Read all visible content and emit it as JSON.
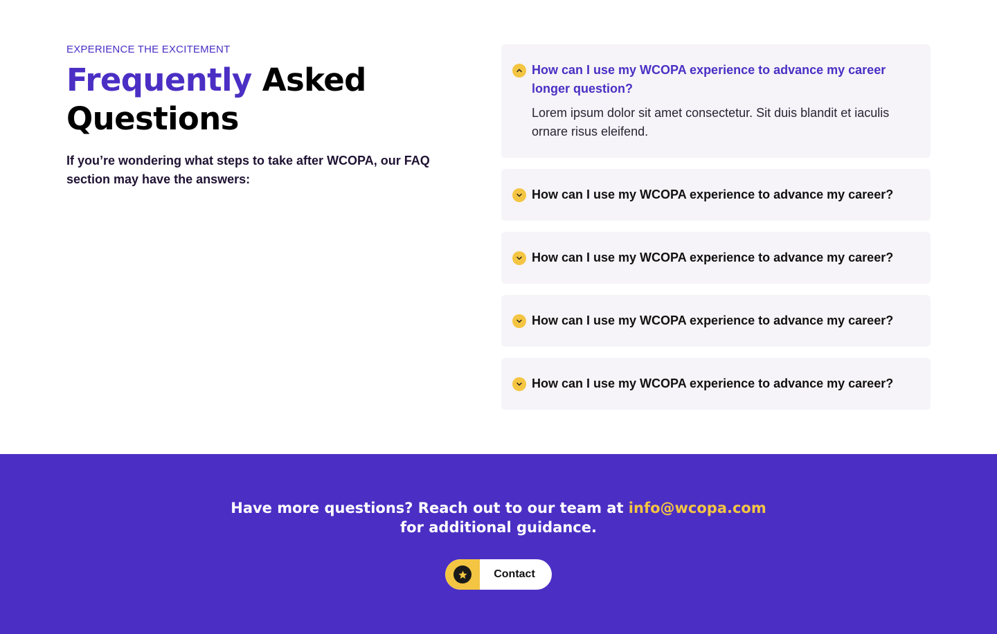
{
  "header": {
    "eyebrow": "EXPERIENCE THE EXCITEMENT",
    "title_accent": "Frequently",
    "title_rest": " Asked Questions",
    "intro": "If you’re wondering what steps to take after WCOPA, our FAQ section may have the answers:"
  },
  "faq": {
    "items": [
      {
        "question": "How can I use my WCOPA experience to advance my career longer question?",
        "answer": "Lorem ipsum dolor sit amet consectetur. Sit duis blandit et iaculis ornare risus eleifend.",
        "expanded": true,
        "icon": "chevron-up-icon"
      },
      {
        "question": "How can I use my WCOPA experience to advance my career?",
        "expanded": false,
        "icon": "chevron-down-icon"
      },
      {
        "question": "How can I use my WCOPA experience to advance my career?",
        "expanded": false,
        "icon": "chevron-down-icon"
      },
      {
        "question": "How can I use my WCOPA experience to advance my career?",
        "expanded": false,
        "icon": "chevron-down-icon"
      },
      {
        "question": "How can I use my WCOPA experience to advance my career?",
        "expanded": false,
        "icon": "chevron-down-icon"
      }
    ]
  },
  "cta": {
    "text_before": "Have more questions? Reach out to our team at ",
    "email": "info@wcopa.com",
    "text_after": " for additional guidance.",
    "button_label": "Contact",
    "button_icon": "star-icon"
  },
  "colors": {
    "brand_purple": "#4b2fc4",
    "accent_yellow": "#f4c542",
    "card_bg": "#f6f4f8"
  }
}
